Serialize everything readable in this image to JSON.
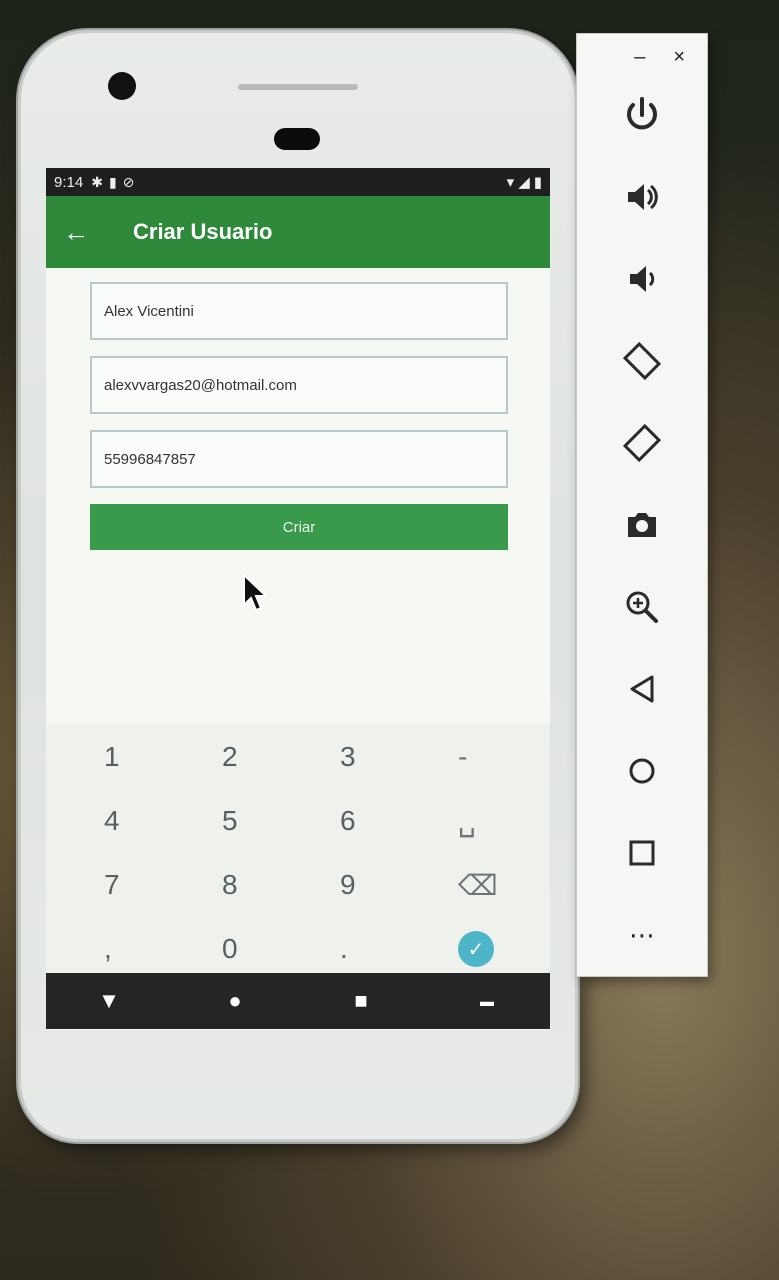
{
  "status_bar": {
    "time": "9:14"
  },
  "app_bar": {
    "title": "Criar Usuario",
    "back_icon": "arrow-left-icon"
  },
  "form": {
    "name_value": "Alex Vicentini",
    "email_value": "alexvvargas20@hotmail.com",
    "phone_value": "55996847857",
    "create_label": "Criar"
  },
  "keyboard": {
    "keys": [
      "1",
      "2",
      "3",
      "-",
      "4",
      "5",
      "6",
      "␣",
      "7",
      "8",
      "9",
      "⌫",
      ",",
      "0",
      ".",
      "✓"
    ]
  },
  "colors": {
    "app_bar": "#2e8a3a",
    "button": "#3a9a4c",
    "check": "#4cb6c8"
  },
  "toolbar": {
    "minimize": "–",
    "close": "×",
    "more": "⋯"
  }
}
